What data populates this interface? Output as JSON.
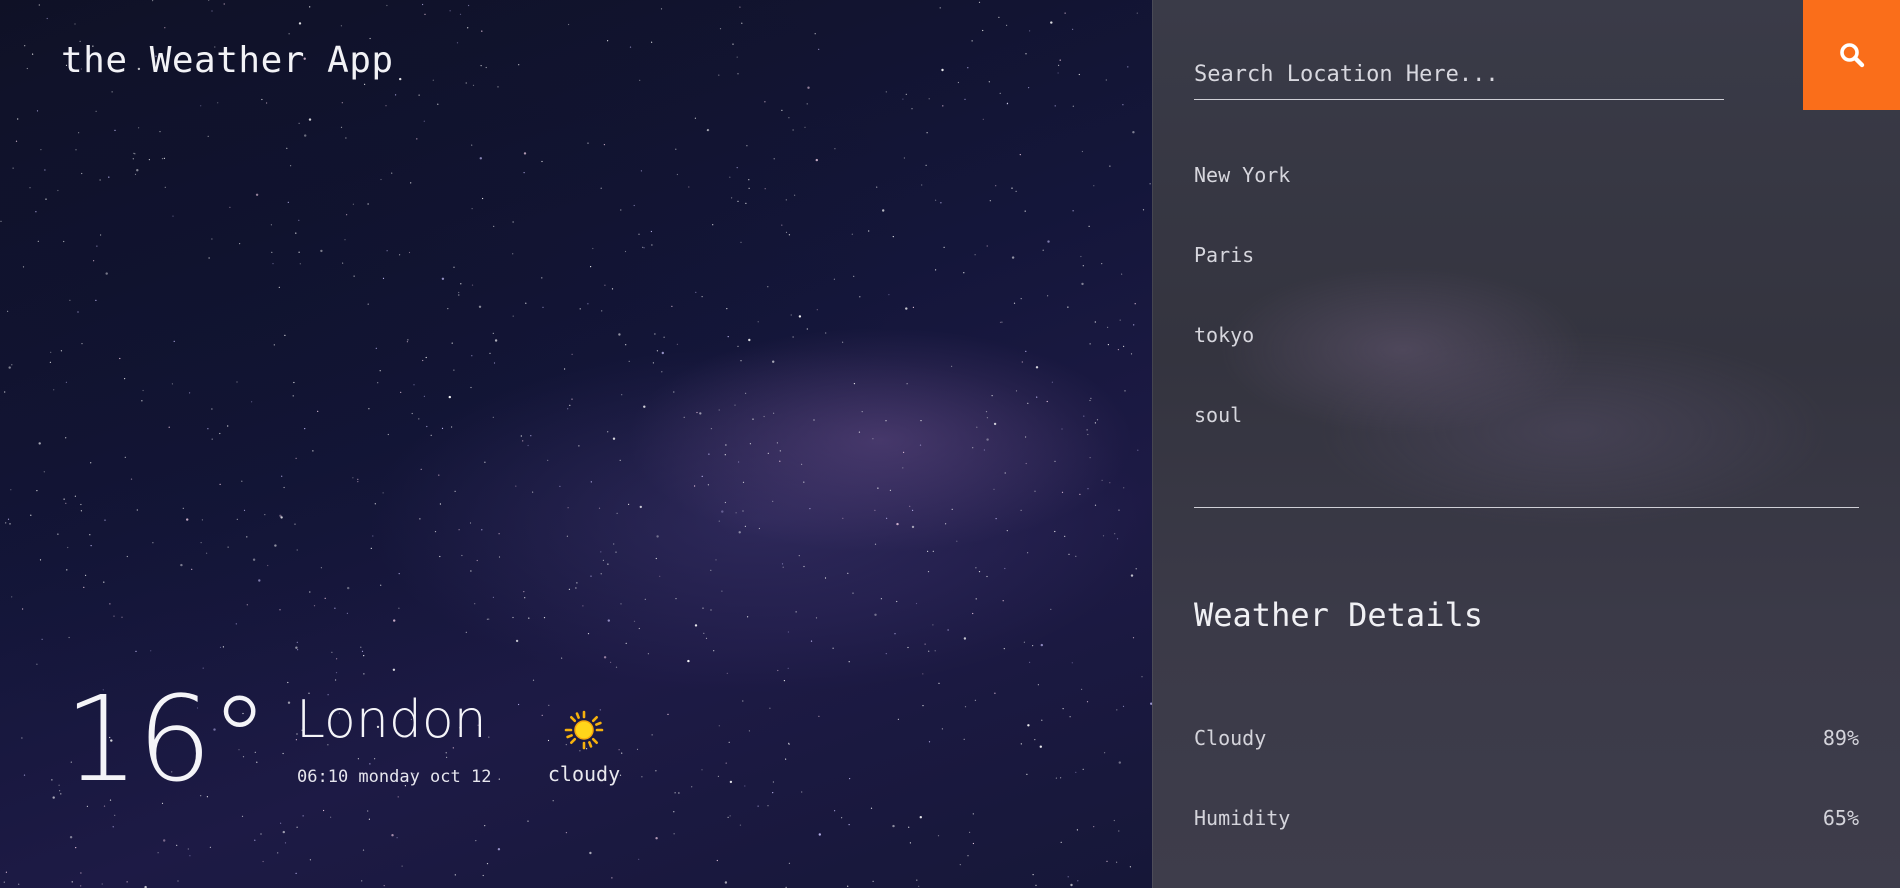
{
  "app": {
    "title": "the Weather App"
  },
  "current": {
    "temperature": "16°",
    "city": "London",
    "datetime": "06:10 monday oct 12",
    "condition": "cloudy",
    "condition_icon": "sun-icon"
  },
  "search": {
    "placeholder": "Search Location Here...",
    "value": "",
    "button_icon": "search-icon",
    "button_color": "#fa6e1a"
  },
  "locations": [
    {
      "label": "New York"
    },
    {
      "label": "Paris"
    },
    {
      "label": "tokyo"
    },
    {
      "label": "soul"
    }
  ],
  "details": {
    "title": "Weather Details",
    "items": [
      {
        "label": "Cloudy",
        "value": "89%"
      },
      {
        "label": "Humidity",
        "value": "65%"
      }
    ]
  }
}
